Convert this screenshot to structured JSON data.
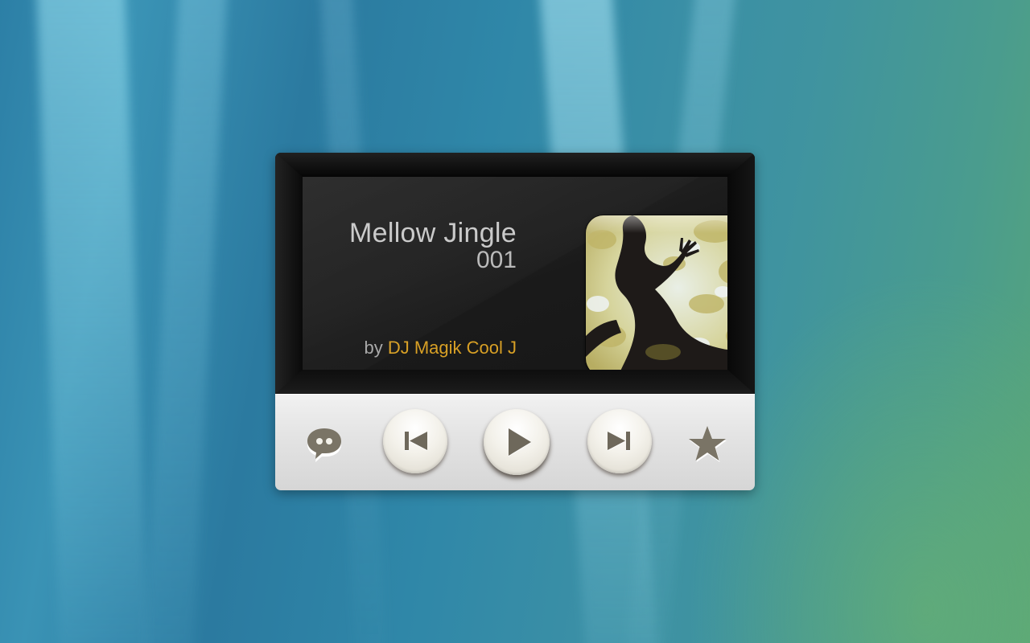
{
  "player": {
    "track_title": "Mellow Jingle",
    "track_number": "001",
    "by_label": "by",
    "artist": "DJ Magik Cool J"
  },
  "controls": {
    "chat": "chat-bubble-icon",
    "previous": "skip-previous-icon",
    "play": "play-icon",
    "next": "skip-next-icon",
    "favorite": "star-icon"
  },
  "colors": {
    "artist_accent": "#d8a025",
    "title_text": "#c9c9c9",
    "display_bg": "#1f1f1f",
    "control_bar_bg": "#e3e3e3",
    "icon_color": "#7a7466"
  }
}
